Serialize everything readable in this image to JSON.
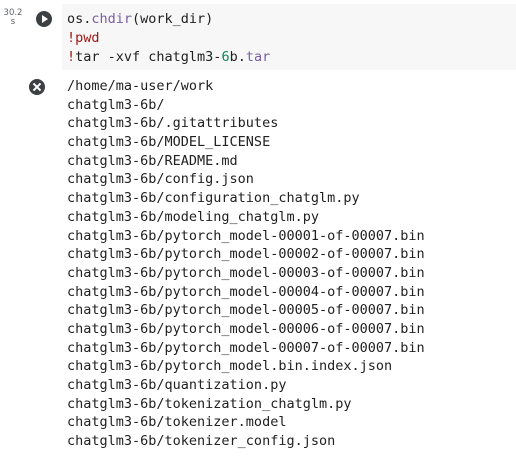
{
  "cell": {
    "exec_time_value": "30.2",
    "exec_time_unit": "s",
    "code_lines": [
      [
        {
          "text": "os.",
          "cls": ""
        },
        {
          "text": "chdir",
          "cls": "tok-fn"
        },
        {
          "text": "(work_dir)",
          "cls": ""
        }
      ],
      [
        {
          "text": "!pwd",
          "cls": "tok-magic"
        }
      ],
      [
        {
          "text": "!",
          "cls": "tok-magic"
        },
        {
          "text": "tar -xvf chatglm3-",
          "cls": ""
        },
        {
          "text": "6",
          "cls": "tok-num"
        },
        {
          "text": "b.",
          "cls": ""
        },
        {
          "text": "tar",
          "cls": "tok-fn"
        }
      ]
    ],
    "run_icon": "play-circle-icon",
    "clear_output_icon": "close-circle-icon"
  },
  "output_lines": [
    "/home/ma-user/work",
    "chatglm3-6b/",
    "chatglm3-6b/.gitattributes",
    "chatglm3-6b/MODEL_LICENSE",
    "chatglm3-6b/README.md",
    "chatglm3-6b/config.json",
    "chatglm3-6b/configuration_chatglm.py",
    "chatglm3-6b/modeling_chatglm.py",
    "chatglm3-6b/pytorch_model-00001-of-00007.bin",
    "chatglm3-6b/pytorch_model-00002-of-00007.bin",
    "chatglm3-6b/pytorch_model-00003-of-00007.bin",
    "chatglm3-6b/pytorch_model-00004-of-00007.bin",
    "chatglm3-6b/pytorch_model-00005-of-00007.bin",
    "chatglm3-6b/pytorch_model-00006-of-00007.bin",
    "chatglm3-6b/pytorch_model-00007-of-00007.bin",
    "chatglm3-6b/pytorch_model.bin.index.json",
    "chatglm3-6b/quantization.py",
    "chatglm3-6b/tokenization_chatglm.py",
    "chatglm3-6b/tokenizer.model",
    "chatglm3-6b/tokenizer_config.json"
  ],
  "colors": {
    "code_background": "#f7f7f7",
    "function_token": "#795da3",
    "magic_token": "#a31515",
    "number_token": "#098658",
    "icon": "#3c4043"
  }
}
